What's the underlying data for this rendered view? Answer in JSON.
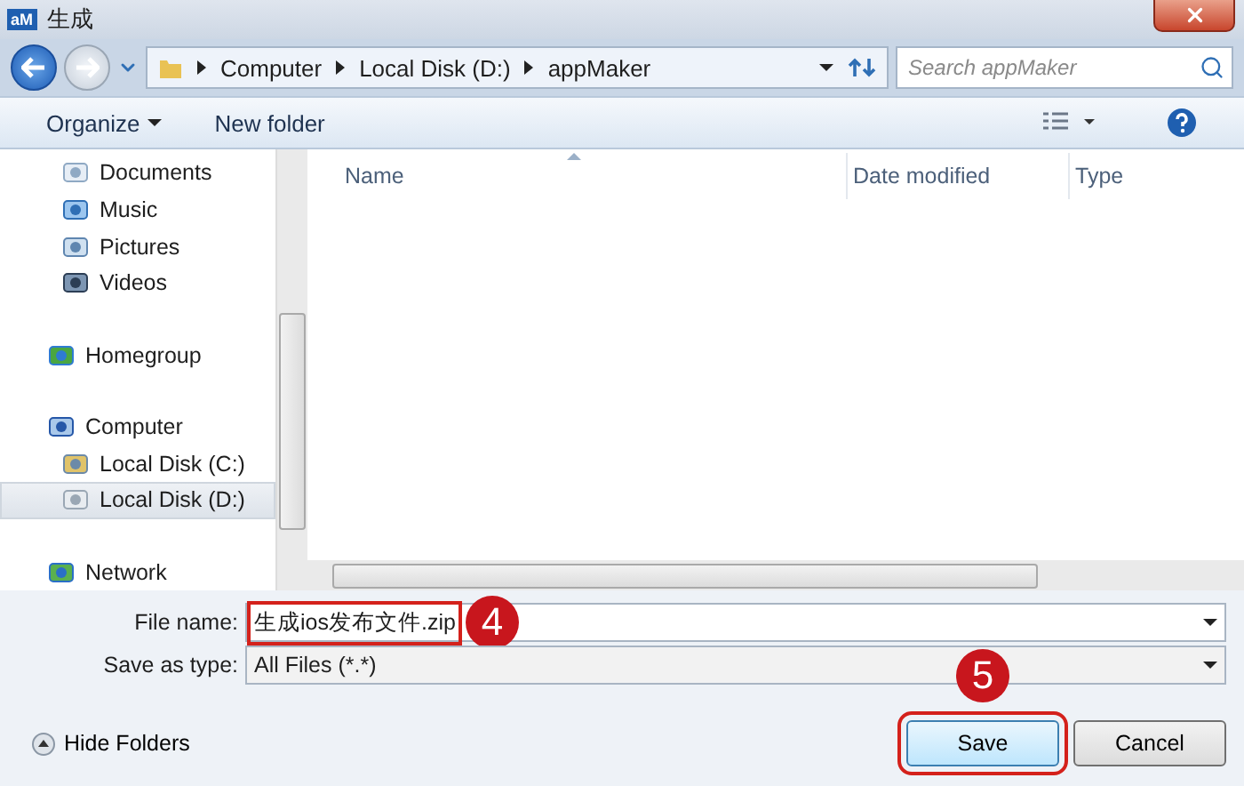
{
  "window": {
    "title": "生成",
    "app_icon": "aM"
  },
  "address": {
    "path": [
      "Computer",
      "Local Disk (D:)",
      "appMaker"
    ]
  },
  "search": {
    "placeholder": "Search appMaker"
  },
  "toolbar": {
    "organize": "Organize",
    "new_folder": "New folder"
  },
  "sidebar": {
    "libraries": [
      {
        "label": "Documents",
        "kind": "documents",
        "selected": false
      },
      {
        "label": "Music",
        "kind": "music",
        "selected": false
      },
      {
        "label": "Pictures",
        "kind": "pictures",
        "selected": false
      },
      {
        "label": "Videos",
        "kind": "videos",
        "selected": false
      }
    ],
    "nodes": [
      {
        "label": "Homegroup",
        "kind": "homegroup",
        "selected": false
      },
      {
        "label": "Computer",
        "kind": "computer",
        "selected": false,
        "children": [
          {
            "label": "Local Disk (C:)",
            "kind": "disk-c",
            "selected": false
          },
          {
            "label": "Local Disk (D:)",
            "kind": "disk",
            "selected": true
          }
        ]
      },
      {
        "label": "Network",
        "kind": "network",
        "selected": false
      }
    ]
  },
  "columns": [
    {
      "label": "Name",
      "sorted": true
    },
    {
      "label": "Date modified",
      "sorted": false
    },
    {
      "label": "Type",
      "sorted": false
    }
  ],
  "form": {
    "file_name_label": "File name:",
    "file_name": "生成ios发布文件.zip",
    "save_type_label": "Save as type:",
    "save_type": "All Files (*.*)"
  },
  "hide_folders": "Hide Folders",
  "buttons": [
    {
      "label": "Save",
      "default": true
    },
    {
      "label": "Cancel",
      "default": false
    }
  ],
  "annotations": [
    {
      "label": "4"
    },
    {
      "label": "5"
    }
  ]
}
